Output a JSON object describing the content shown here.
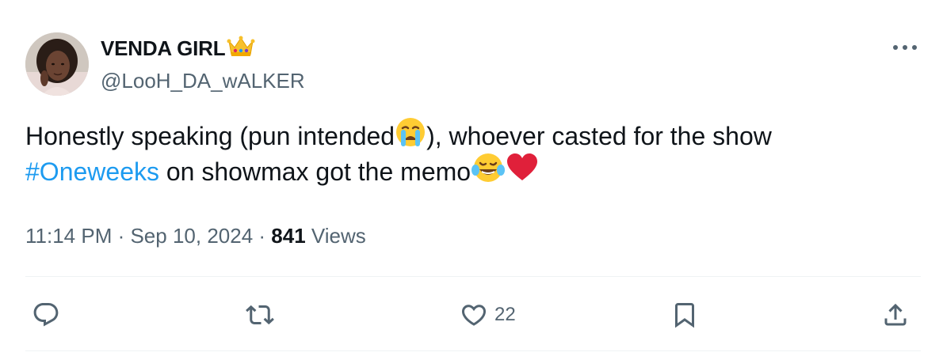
{
  "author": {
    "display_name": "VENDA GIRL",
    "handle": "@LooH_DA_wALKER",
    "name_emoji": "crown-emoji"
  },
  "tweet": {
    "line1_before": "Honestly speaking (pun intended",
    "line1_emoji": "loudly-crying-face-emoji",
    "line1_after": "), whoever casted for the show",
    "hashtag": "#Oneweeks",
    "line2_after": " on showmax got the memo",
    "line2_emojis": [
      "face-with-tears-of-joy-emoji",
      "red-heart-emoji"
    ]
  },
  "meta": {
    "time": "11:14 PM",
    "separator": " · ",
    "date": "Sep 10, 2024",
    "views_count": "841",
    "views_label": " Views"
  },
  "actions": {
    "reply": {
      "icon": "reply-icon",
      "count": ""
    },
    "retweet": {
      "icon": "retweet-icon",
      "count": ""
    },
    "like": {
      "icon": "heart-icon",
      "count": "22"
    },
    "bookmark": {
      "icon": "bookmark-icon",
      "count": ""
    },
    "share": {
      "icon": "share-icon",
      "count": ""
    }
  },
  "colors": {
    "text": "#0f1419",
    "secondary": "#536471",
    "link": "#1d9bf0",
    "divider": "#eff3f4"
  }
}
